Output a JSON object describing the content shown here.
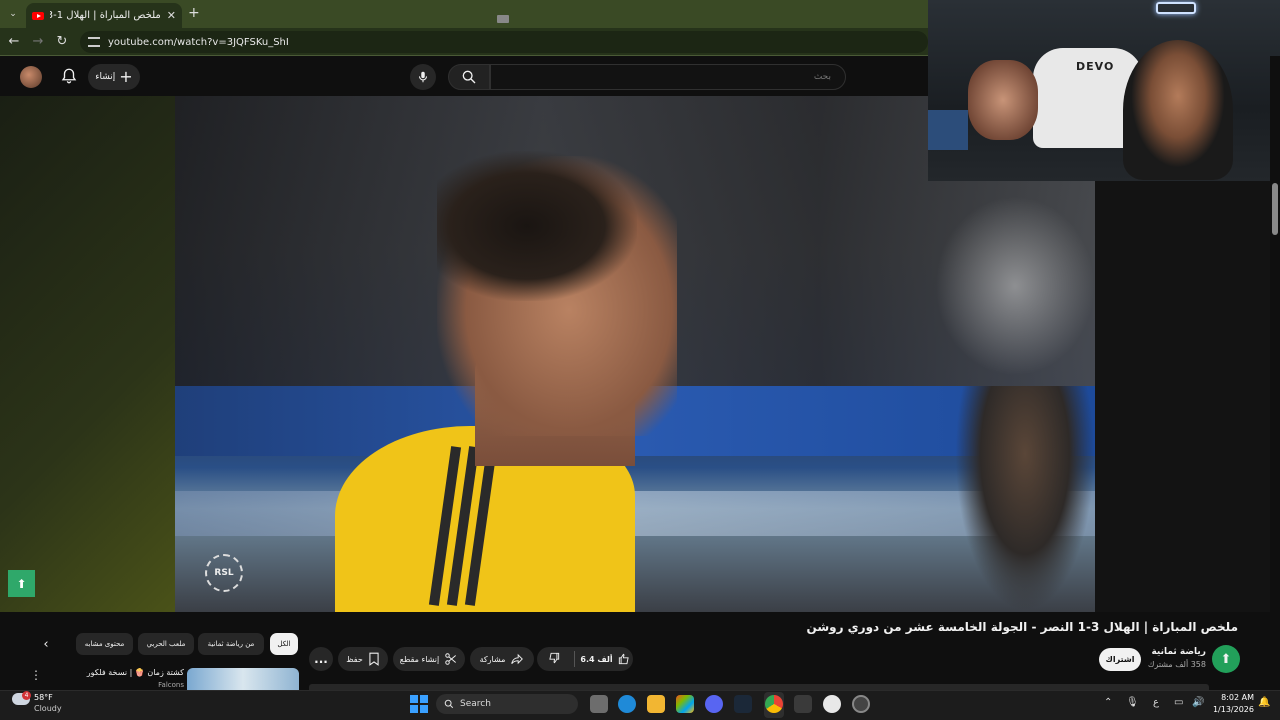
{
  "browser": {
    "tab_title": "ملخص المباراة | الهلال 1-3 النصر",
    "url": "youtube.com/watch?v=3JQFSKu_ShI"
  },
  "youtube_header": {
    "create_label": "إنشاء",
    "search_placeholder": "بحث"
  },
  "webcam": {
    "chair_brand": "DEVO"
  },
  "video": {
    "watermark": "RSL",
    "title": "ملخص المباراة | الهلال 3-1 النصر - الجولة الخامسة عشر من دوري روشن"
  },
  "channel": {
    "name": "رياضة ثمانية",
    "subscribers": "358 ألف مشترك",
    "subscribe_label": "اشتراك"
  },
  "actions": {
    "likes": "6.4 ألف",
    "share_label": "مشاركة",
    "clip_label": "إنشاء مقطع",
    "save_label": "حفظ",
    "more_label": "..."
  },
  "chips": [
    {
      "label": "الكل",
      "active": true
    },
    {
      "label": "من رياضة ثمانية"
    },
    {
      "label": "ملعب الحربي"
    },
    {
      "label": "محتوى مشابه"
    }
  ],
  "recommendation": {
    "title": "كشتة زمان 🍿 | نسخة فلكوري",
    "channel": "Falcons"
  },
  "taskbar": {
    "weather_temp": "58°F",
    "weather_condition": "Cloudy",
    "weather_badge": "4",
    "search_label": "Search",
    "time": "8:02 AM",
    "date": "1/13/2026",
    "lang": "ع"
  },
  "colors": {
    "accent_red": "#ff0000",
    "tab_bar": "#3a4a25",
    "channel_green": "#22a05a",
    "windows_blue": "#3aa0ff"
  }
}
